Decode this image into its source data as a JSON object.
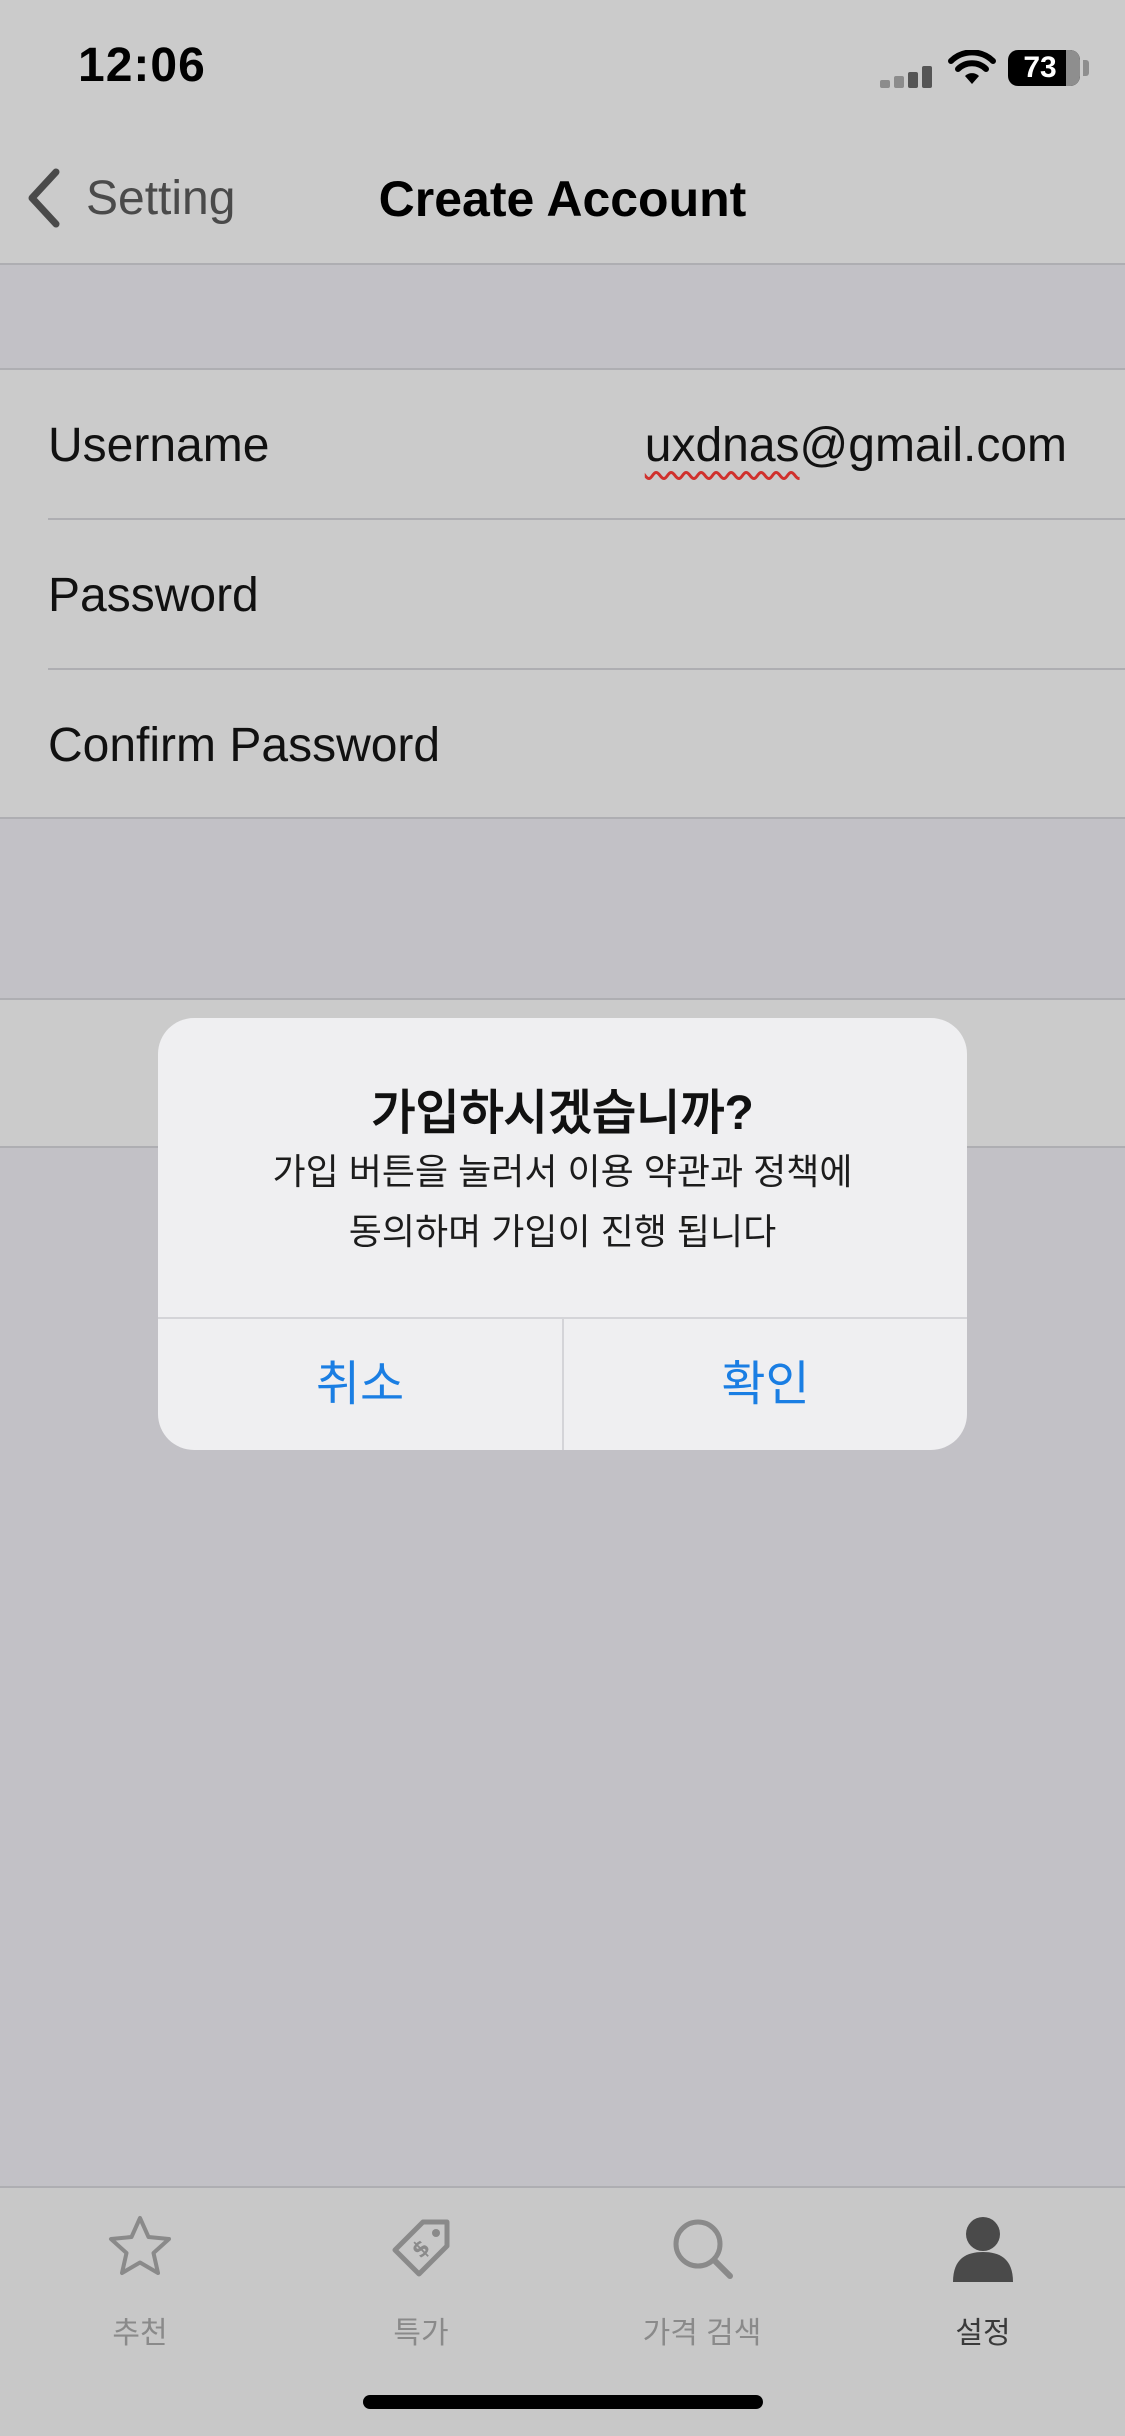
{
  "status_bar": {
    "time": "12:06",
    "battery": "73",
    "signal_icon": "cellular-signal-icon",
    "wifi_icon": "wifi-icon",
    "battery_icon": "battery-icon"
  },
  "nav": {
    "back_label": "Setting",
    "back_icon": "chevron-left-icon",
    "title": "Create Account"
  },
  "form": {
    "rows": [
      {
        "label": "Username",
        "value": "uxdnas@gmail.com",
        "value_underlined": "uxdnas",
        "value_rest": "@gmail.com"
      },
      {
        "label": "Password",
        "value": ""
      },
      {
        "label": "Confirm Password",
        "value": ""
      }
    ]
  },
  "alert": {
    "title": "가입하시겠습니까?",
    "message_line1": "가입 버튼을 눌러서 이용 약관과 정책에",
    "message_line2": "동의하며 가입이 진행 됩니다",
    "cancel_label": "취소",
    "confirm_label": "확인"
  },
  "tab_bar": {
    "items": [
      {
        "label": "추천",
        "icon": "star-icon",
        "active": false
      },
      {
        "label": "특가",
        "icon": "price-tag-icon",
        "active": false
      },
      {
        "label": "가격 검색",
        "icon": "search-icon",
        "active": false
      },
      {
        "label": "설정",
        "icon": "person-icon",
        "active": true
      }
    ]
  },
  "colors": {
    "accent": "#1a7ee3",
    "dim_background": "#c2c1c6",
    "alert_background": "#efeff1"
  }
}
